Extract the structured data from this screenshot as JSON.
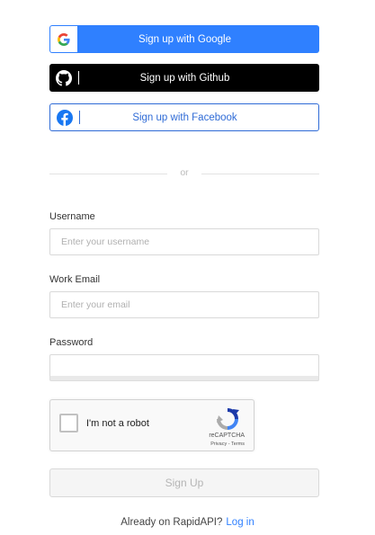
{
  "social": {
    "google_label": "Sign up with Google",
    "github_label": "Sign up with Github",
    "facebook_label": "Sign up with Facebook"
  },
  "divider": {
    "text": "or"
  },
  "form": {
    "username_label": "Username",
    "username_placeholder": "Enter your username",
    "email_label": "Work Email",
    "email_placeholder": "Enter your email",
    "password_label": "Password",
    "password_placeholder": ""
  },
  "recaptcha": {
    "label": "I'm not a robot",
    "brand": "reCAPTCHA",
    "terms": "Privacy - Terms"
  },
  "signup_button": "Sign Up",
  "footer": {
    "prompt": "Already on RapidAPI?",
    "login_link": "Log in"
  },
  "colors": {
    "google_blue": "#2f80ff",
    "github_black": "#000000",
    "facebook_blue": "#2f6bd6"
  },
  "icons": [
    "google-icon",
    "github-icon",
    "facebook-icon",
    "recaptcha-icon"
  ]
}
